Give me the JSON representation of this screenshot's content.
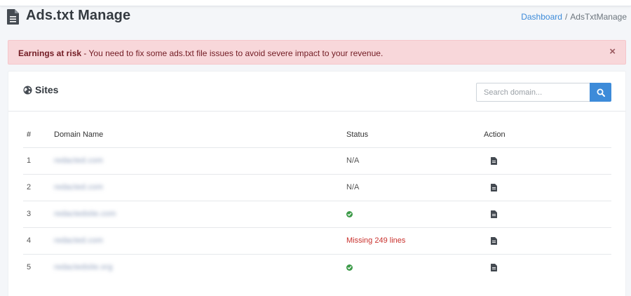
{
  "page": {
    "title": "Ads.txt Manage",
    "title_icon": "file-icon"
  },
  "breadcrumb": {
    "items": [
      {
        "label": "Dashboard",
        "link": true
      },
      {
        "label": "AdsTxtManage",
        "link": false
      }
    ],
    "separator": "/"
  },
  "alert": {
    "strong": "Earnings at risk",
    "message": " - You need to fix some ads.txt file issues to avoid severe impact to your revenue.",
    "close": "×",
    "color": "#721c24",
    "background": "#f8d7da"
  },
  "sites": {
    "title": "Sites",
    "icon": "globe-icon",
    "search": {
      "placeholder": "Search domain...",
      "value": "",
      "button_icon": "search-icon"
    },
    "accent": "#3d8bd9",
    "columns": {
      "num": "#",
      "domain": "Domain Name",
      "status": "Status",
      "action": "Action"
    },
    "rows": [
      {
        "num": "1",
        "domain": "redacted.com",
        "status": "N/A",
        "status_type": "na"
      },
      {
        "num": "2",
        "domain": "redacted.com",
        "status": "N/A",
        "status_type": "na"
      },
      {
        "num": "3",
        "domain": "redactedsite.com",
        "status": "",
        "status_type": "ok"
      },
      {
        "num": "4",
        "domain": "redacted.com",
        "status": "Missing 249 lines",
        "status_type": "error"
      },
      {
        "num": "5",
        "domain": "redactedsite.org",
        "status": "",
        "status_type": "ok"
      }
    ],
    "status_colors": {
      "ok": "#3c9a48",
      "error": "#c9302c"
    },
    "action_icon": "document-icon"
  }
}
